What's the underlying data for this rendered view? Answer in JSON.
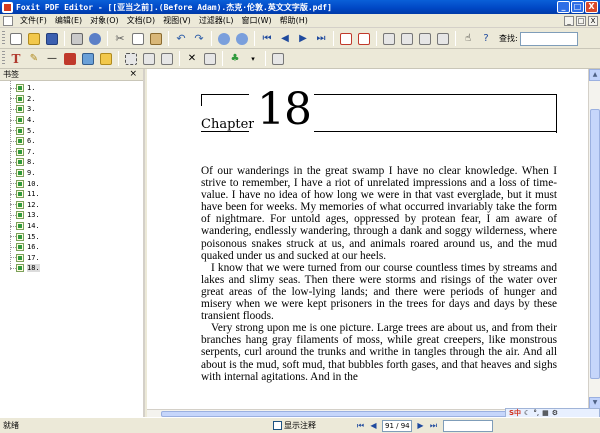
{
  "window": {
    "title": "Foxit PDF Editor - [[亚当之前].(Before Adam).杰克·伦敦.英文文字版.pdf]",
    "controls": [
      "_",
      "□",
      "X"
    ]
  },
  "menu": {
    "items": [
      "文件(F)",
      "编辑(E)",
      "对象(O)",
      "文档(D)",
      "视图(V)",
      "过滤器(L)",
      "窗口(W)",
      "帮助(H)"
    ],
    "mdi_controls": [
      "_",
      "□",
      "X"
    ]
  },
  "toolbar": {
    "search_label": "查找:"
  },
  "bookmarks": {
    "header": "书签",
    "close": "×",
    "items": [
      "1.",
      "2.",
      "3.",
      "4.",
      "5.",
      "6.",
      "7.",
      "8.",
      "9.",
      "10.",
      "11.",
      "12.",
      "13.",
      "14.",
      "15.",
      "16.",
      "17.",
      "18."
    ],
    "selected_index": 17
  },
  "document": {
    "chapter_word": "Chapter",
    "chapter_number": "18",
    "paragraphs": [
      "Of our wanderings in the great swamp I have no clear knowledge. When I strive to remember, I have a riot of unrelated impressions and a loss of time-value. I have no idea of how long we were in that vast everglade, but it must have been for weeks. My memories of what occurred invariably take the form of nightmare. For untold ages, oppressed by protean fear, I am aware of wandering, endlessly wandering, through a dank and soggy wilderness, where poisonous snakes struck at us, and animals roared around us, and the mud quaked under us and sucked at our heels.",
      "I know that we were turned from our course countless times by streams and lakes and slimy seas. Then there were storms and risings of the water over great areas of the low-lying lands; and there were periods of hunger and misery when we were kept prisoners in the trees for days and days by these transient floods.",
      "Very strong upon me is one picture. Large trees are about us, and from their branches hang gray filaments of moss, while great creepers, like monstrous serpents, curl around the trunks and writhe in tangles through the air. And all about is the mud, soft mud, that bubbles forth gases, and that heaves and sighs with internal agitations. And in the"
    ]
  },
  "status": {
    "text": "就绪",
    "checkbox_label": "显示注释",
    "page": "91 / 94"
  },
  "ime": {
    "label": "S中"
  },
  "colors": {
    "titlebar": "#0046c4",
    "chrome": "#ece9d8",
    "accent": "#1f4a9e"
  }
}
